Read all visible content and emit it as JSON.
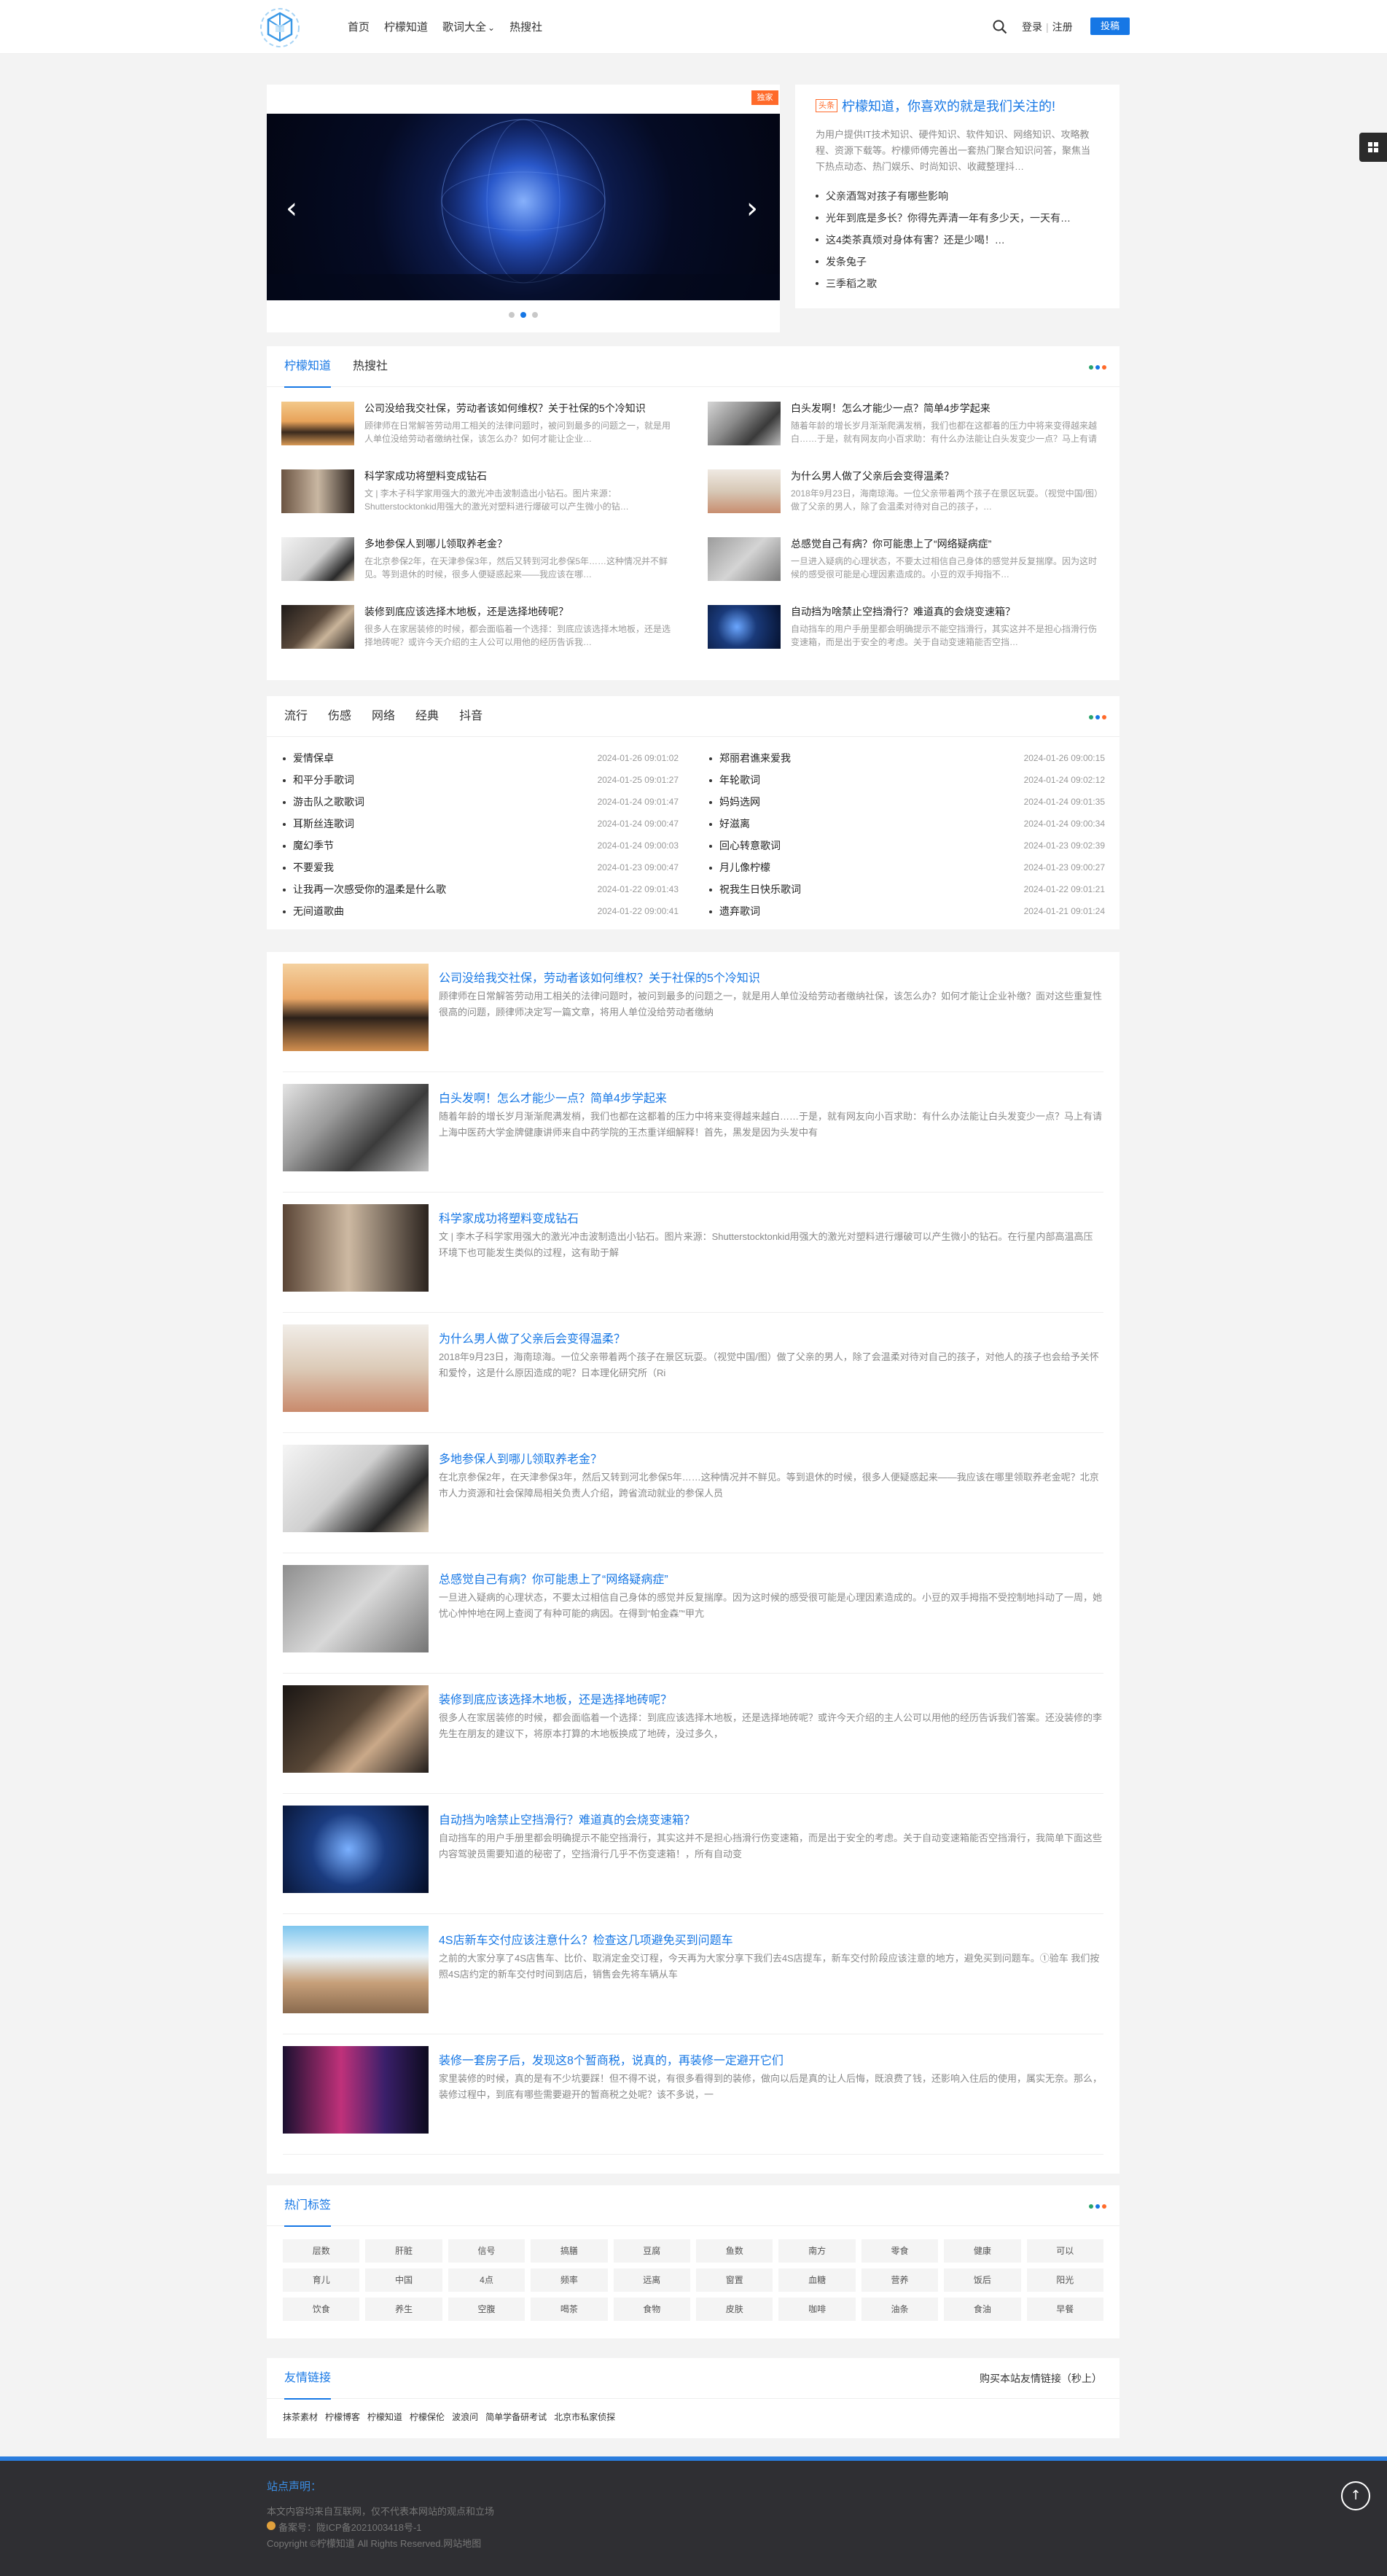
{
  "header": {
    "nav": [
      "首页",
      "柠檬知道",
      "歌词大全",
      "热搜社"
    ],
    "nav_dropdown_marker": "⌄",
    "login": "登录",
    "register": "注册",
    "submit": "投稿"
  },
  "slider": {
    "badge": "独家",
    "prev": "‹",
    "next": "›"
  },
  "intro": {
    "tag": "头条",
    "title": "柠檬知道，你喜欢的就是我们关注的!",
    "desc": "为用户提供IT技术知识、硬件知识、软件知识、网络知识、攻略教程、资源下载等。柠檬师傅完善出一套热门聚合知识问答，聚焦当下热点动态、热门娱乐、时尚知识、收藏整理抖…",
    "items": [
      "父亲酒驾对孩子有哪些影响",
      "光年到底是多长？你得先弄清一年有多少天，一天有…",
      "这4类茶真烦对身体有害？还是少喝！…",
      "发条兔子",
      "三季稻之歌"
    ]
  },
  "tabs": {
    "items": [
      "柠檬知道",
      "热搜社"
    ],
    "articles": [
      {
        "title": "公司没给我交社保，劳动者该如何维权？关于社保的5个冷知识",
        "desc": "顾律师在日常解答劳动用工相关的法律问题时，被问到最多的问题之一，就是用人单位没给劳动者缴纳社保，该怎么办？如何才能让企业…"
      },
      {
        "title": "白头发啊！怎么才能少一点？简单4步学起来",
        "desc": "随着年龄的增长岁月渐渐爬满发梢，我们也都在这都着的压力中将来变得越来越白……于是，就有网友向小百求助：有什么办法能让白头发变少一点？马上有请上海…"
      },
      {
        "title": "科学家成功将塑料变成钻石",
        "desc": "文 | 李木子科学家用强大的激光冲击波制造出小钻石。图片来源：Shutterstocktonkid用强大的激光对塑料进行爆破可以产生微小的钻…"
      },
      {
        "title": "为什么男人做了父亲后会变得温柔？",
        "desc": "2018年9月23日，海南琼海。一位父亲带着两个孩子在景区玩耍。（视觉中国/图）做了父亲的男人，除了会温柔对待对自己的孩子，…"
      },
      {
        "title": "多地参保人到哪儿领取养老金？",
        "desc": "在北京参保2年，在天津参保3年，然后又转到河北参保5年……这种情况并不鲜见。等到退休的时候，很多人便疑惑起来——我应该在哪…"
      },
      {
        "title": "总感觉自己有病？你可能患上了“网络疑病症”",
        "desc": "一旦进入疑病的心理状态，不要太过相信自己身体的感觉并反复揣摩。因为这时候的感受很可能是心理因素造成的。小豆的双手拇指不…"
      },
      {
        "title": "装修到底应该选择木地板，还是选择地砖呢？",
        "desc": "很多人在家居装修的时候，都会面临着一个选择：到底应该选择木地板，还是选择地砖呢？或许今天介绍的主人公可以用他的经历告诉我…"
      },
      {
        "title": "自动挡为啥禁止空挡滑行？难道真的会烧变速箱？",
        "desc": "自动挡车的用户手册里都会明确提示不能空挡滑行，其实这并不是担心挡滑行伤变速箱，而是出于安全的考虑。关于自动变速箱能否空挡…"
      }
    ]
  },
  "music": {
    "tabs": [
      "流行",
      "伤感",
      "网络",
      "经典",
      "抖音"
    ],
    "left": [
      {
        "title": "爱情保卓",
        "date": "2024-01-26 09:01:02"
      },
      {
        "title": "和平分手歌词",
        "date": "2024-01-25 09:01:27"
      },
      {
        "title": "游击队之歌歌词",
        "date": "2024-01-24 09:01:47"
      },
      {
        "title": "耳斯丝连歌词",
        "date": "2024-01-24 09:00:47"
      },
      {
        "title": "魔幻季节",
        "date": "2024-01-24 09:00:03"
      },
      {
        "title": "不要爱我",
        "date": "2024-01-23 09:00:47"
      },
      {
        "title": "让我再一次感受你的温柔是什么歌",
        "date": "2024-01-22 09:01:43"
      },
      {
        "title": "无间道歌曲",
        "date": "2024-01-22 09:00:41"
      }
    ],
    "right": [
      {
        "title": "郑丽君谯来爱我",
        "date": "2024-01-26 09:00:15"
      },
      {
        "title": "年轮歌词",
        "date": "2024-01-24 09:02:12"
      },
      {
        "title": "妈妈选网",
        "date": "2024-01-24 09:01:35"
      },
      {
        "title": "好滋离",
        "date": "2024-01-24 09:00:34"
      },
      {
        "title": "回心转意歌词",
        "date": "2024-01-23 09:02:39"
      },
      {
        "title": "月儿像柠檬",
        "date": "2024-01-23 09:00:27"
      },
      {
        "title": "祝我生日快乐歌词",
        "date": "2024-01-22 09:01:21"
      },
      {
        "title": "遗弃歌词",
        "date": "2024-01-21 09:01:24"
      }
    ]
  },
  "list": [
    {
      "title": "公司没给我交社保，劳动者该如何维权？关于社保的5个冷知识",
      "desc": "顾律师在日常解答劳动用工相关的法律问题时，被问到最多的问题之一，就是用人单位没给劳动者缴纳社保，该怎么办？如何才能让企业补缴？面对这些重复性很高的问题，顾律师决定写一篇文章，将用人单位没给劳动者缴纳"
    },
    {
      "title": "白头发啊！怎么才能少一点？简单4步学起来",
      "desc": "随着年龄的增长岁月渐渐爬满发梢，我们也都在这都着的压力中将来变得越来越白……于是，就有网友向小百求助：有什么办法能让白头发变少一点？马上有请上海中医药大学金牌健康讲师来自中药学院的王杰重详细解释！首先，黑发是因为头发中有"
    },
    {
      "title": "科学家成功将塑料变成钻石",
      "desc": "文 | 李木子科学家用强大的激光冲击波制造出小钻石。图片来源：Shutterstocktonkid用强大的激光对塑料进行爆破可以产生微小的钻石。在行星内部高温高压环境下也可能发生类似的过程，这有助于解"
    },
    {
      "title": "为什么男人做了父亲后会变得温柔？",
      "desc": "2018年9月23日，海南琼海。一位父亲带着两个孩子在景区玩耍。（视觉中国/图）做了父亲的男人，除了会温柔对待对自己的孩子，对他人的孩子也会给予关怀和爱怜，这是什么原因造成的呢？日本理化研究所（Ri"
    },
    {
      "title": "多地参保人到哪儿领取养老金？",
      "desc": "在北京参保2年，在天津参保3年，然后又转到河北参保5年……这种情况并不鲜见。等到退休的时候，很多人便疑惑起来——我应该在哪里领取养老金呢？北京市人力资源和社会保障局相关负责人介绍，跨省流动就业的参保人员"
    },
    {
      "title": "总感觉自己有病？你可能患上了“网络疑病症”",
      "desc": "一旦进入疑病的心理状态，不要太过相信自己身体的感觉并反复揣摩。因为这时候的感受很可能是心理因素造成的。小豆的双手拇指不受控制地抖动了一周，她忧心忡忡地在网上查阅了有种可能的病因。在得到“帕金森”“甲亢"
    },
    {
      "title": "装修到底应该选择木地板，还是选择地砖呢？",
      "desc": "很多人在家居装修的时候，都会面临着一个选择：到底应该选择木地板，还是选择地砖呢？或许今天介绍的主人公可以用他的经历告诉我们答案。还没装修的李先生在朋友的建议下，将原本打算的木地板换成了地砖，没过多久，"
    },
    {
      "title": "自动挡为啥禁止空挡滑行？难道真的会烧变速箱？",
      "desc": "自动挡车的用户手册里都会明确提示不能空挡滑行，其实这并不是担心挡滑行伤变速箱，而是出于安全的考虑。关于自动变速箱能否空挡滑行，我简单下面这些内容驾驶员需要知道的秘密了，空挡滑行几乎不伤变速箱！，所有自动变"
    },
    {
      "title": "4S店新车交付应该注意什么？检查这几项避免买到问题车",
      "desc": "之前的大家分享了4S店售车、比价、取消定金交订程，今天再为大家分享下我们去4S店提车，新车交付阶段应该注意的地方，避免买到问题车。①验车 我们按照4S店约定的新车交付时间到店后，销售会先将车辆从车"
    },
    {
      "title": "装修一套房子后，发现这8个暂商税，说真的，再装修一定避开它们",
      "desc": "家里装修的时候，真的是有不少坑要踩！但不得不说，有很多看得到的装修，做向以后是真的让人后悔，既浪费了钱，还影响入住后的使用，属实无奈。那么，装修过程中，到底有哪些需要避开的暂商税之处呢？该不多说，一"
    }
  ],
  "hot_tags": {
    "title": "热门标签",
    "items": [
      "层数",
      "肝脏",
      "信号",
      "搞膳",
      "豆腐",
      "鱼数",
      "南方",
      "零食",
      "健康",
      "可以",
      "育儿",
      "中国",
      "4点",
      "频率",
      "远离",
      "窗置",
      "血糖",
      "营养",
      "饭后",
      "阳光",
      "饮食",
      "养生",
      "空腹",
      "喝茶",
      "食物",
      "皮肤",
      "咖啡",
      "油条",
      "食油",
      "早餐"
    ]
  },
  "friend_links": {
    "title": "友情链接",
    "buy_label": "购买本站友情链接（秒上）",
    "items": [
      "抹茶素材",
      "柠檬博客",
      "柠檬知道",
      "柠檬保伦",
      "波浪问",
      "简单学备研考试",
      "北京市私家侦探"
    ]
  },
  "footer": {
    "title": "站点声明：",
    "line1": "本文内容均来自互联网，仅不代表本网站的观点和立场",
    "line2": "备案号：陇ICP备2021003418号-1",
    "line3": "Copyright ©柠檬知道 All Rights Reserved.网站地图",
    "to_top": "↑"
  },
  "colors": {
    "accent": "#1677e5",
    "orange": "#ff6a2a",
    "footer_bg": "#2f2f33"
  }
}
